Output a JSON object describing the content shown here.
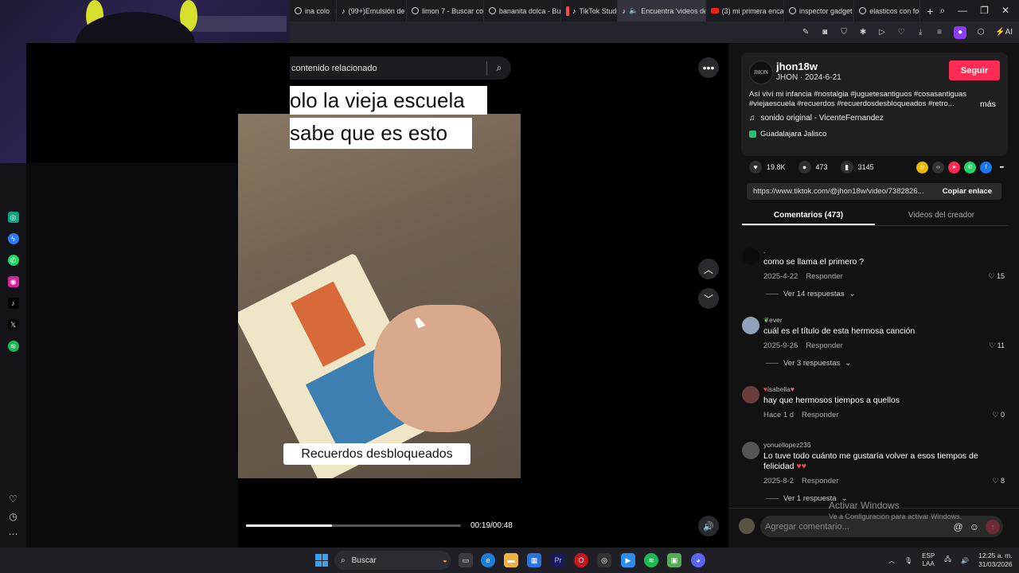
{
  "browser": {
    "tabs": [
      {
        "label": "ina colo",
        "icon": "google"
      },
      {
        "label": "(99+)Emulsión de",
        "icon": "tiktok"
      },
      {
        "label": "limon 7 - Buscar co",
        "icon": "google"
      },
      {
        "label": "bananita dolca - Bu",
        "icon": "google"
      },
      {
        "label": "TikTok Studio",
        "icon": "tiktok"
      },
      {
        "label": "Encuentra 'videos de",
        "icon": "tiktok",
        "active": true
      },
      {
        "label": "(3) mi primera enca",
        "icon": "youtube"
      },
      {
        "label": "inspector gadget",
        "icon": "google"
      },
      {
        "label": "elasticos con form",
        "icon": "google"
      }
    ],
    "new_tab": "+",
    "toolbar_ai": "AI"
  },
  "video": {
    "search_placeholder": "contenido relacionado",
    "caption_top_1": "olo la vieja escuela",
    "caption_top_2": "sabe que es esto",
    "caption_bottom": "Recuerdos desbloqueados",
    "time": "00:19/00:48",
    "progress": 0.4
  },
  "post": {
    "avatar_text": "JHON",
    "username": "jhon18w",
    "subtitle": "JHON · 2024-6-21",
    "follow": "Seguir",
    "description": "Así viví mi infancia #nostalgia #juguetesantiguos #cosasantiguas #viejaescuela #recuerdos #recuerdosdesbloqueados #retro...",
    "more": "más",
    "sound": "sonido original - VicenteFernandez",
    "location": "Guadalajara Jalisco",
    "likes": "19.8K",
    "comments_count": "473",
    "saves": "3145",
    "link": "https://www.tiktok.com/@jhon18w/video/7382826...",
    "copy_link": "Copiar enlace",
    "tab_comments": "Comentarios (473)",
    "tab_creator": "Videos del creador"
  },
  "comments": [
    {
      "name": ".",
      "text": "como se llama el primero ?",
      "date": "2025-4-22",
      "reply": "Responder",
      "likes": "15",
      "replies": "Ver 14 respuestas"
    },
    {
      "name": "ever",
      "text": "cuál es el título de esta hermosa canción",
      "date": "2025-9-26",
      "reply": "Responder",
      "likes": "11",
      "replies": "Ver 3 respuestas"
    },
    {
      "name": "isabella",
      "text": "hay que hermosos tiempos a quellos",
      "date": "Hace 1 d",
      "reply": "Responder",
      "likes": "0",
      "replies": ""
    },
    {
      "name": "yonuellopez235",
      "text": "Lo tuve todo cuánto me gustaría volver a esos tiempos de felicidad",
      "date": "2025-8-2",
      "reply": "Responder",
      "likes": "8",
      "replies": "Ver 1 respuesta"
    }
  ],
  "comment_input_placeholder": "Agregar comentario...",
  "watermark": {
    "title": "Activar Windows",
    "sub": "Ve a Configuración para activar Windows."
  },
  "taskbar": {
    "search": "Buscar",
    "lang_1": "ESP",
    "lang_2": "LAA",
    "time": "12:25 a. m.",
    "date": "31/03/2026"
  },
  "colors": {
    "accent": "#fe2c55",
    "panel": "#121212",
    "card": "#1f1f1f"
  }
}
